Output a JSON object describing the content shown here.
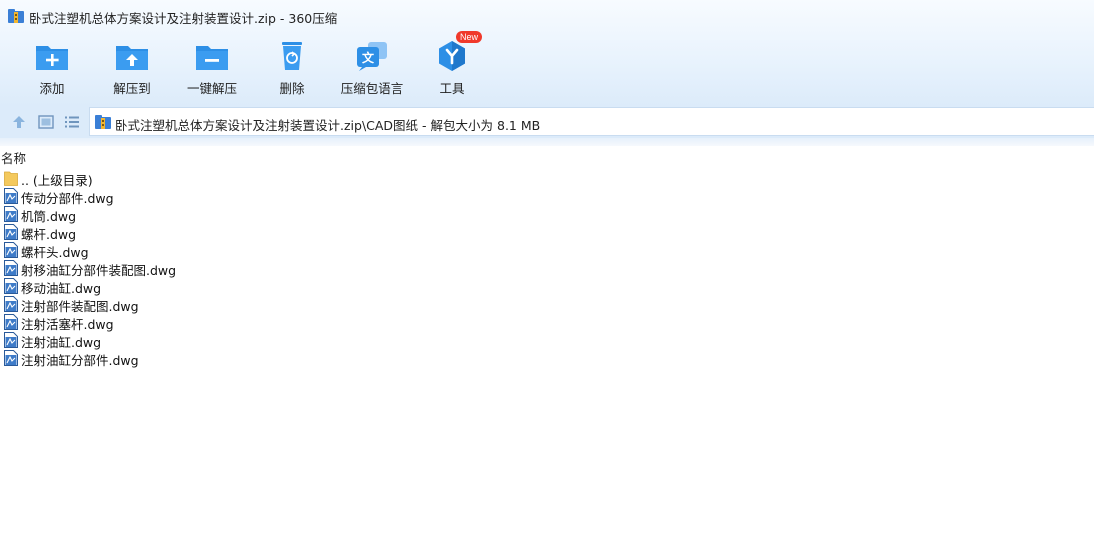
{
  "window": {
    "title": "卧式注塑机总体方案设计及注射装置设计.zip - 360压缩"
  },
  "toolbar": {
    "items": [
      {
        "label": "添加",
        "icon": "folder-add-icon",
        "color": "#2d8fe6"
      },
      {
        "label": "解压到",
        "icon": "folder-extract-icon",
        "color": "#2d8fe6"
      },
      {
        "label": "一键解压",
        "icon": "folder-minus-icon",
        "color": "#2d8fe6"
      },
      {
        "label": "删除",
        "icon": "trash-recycle-icon",
        "color": "#2d8fe6"
      },
      {
        "label": "压缩包语言",
        "icon": "language-icon",
        "color": "#2d8fe6"
      },
      {
        "label": "工具",
        "icon": "tools-hexagon-icon",
        "color": "#2d8fe6",
        "badge": "New"
      }
    ]
  },
  "address": {
    "path": "卧式注塑机总体方案设计及注射装置设计.zip\\CAD图纸 - 解包大小为 8.1 MB"
  },
  "list": {
    "column_name": "名称",
    "rows": [
      {
        "name": ".. (上级目录)",
        "type": "folder"
      },
      {
        "name": "传动分部件.dwg",
        "type": "dwg"
      },
      {
        "name": "机筒.dwg",
        "type": "dwg"
      },
      {
        "name": "螺杆.dwg",
        "type": "dwg"
      },
      {
        "name": "螺杆头.dwg",
        "type": "dwg"
      },
      {
        "name": "射移油缸分部件装配图.dwg",
        "type": "dwg"
      },
      {
        "name": "移动油缸.dwg",
        "type": "dwg"
      },
      {
        "name": "注射部件装配图.dwg",
        "type": "dwg"
      },
      {
        "name": "注射活塞杆.dwg",
        "type": "dwg"
      },
      {
        "name": "注射油缸.dwg",
        "type": "dwg"
      },
      {
        "name": "注射油缸分部件.dwg",
        "type": "dwg"
      }
    ]
  }
}
